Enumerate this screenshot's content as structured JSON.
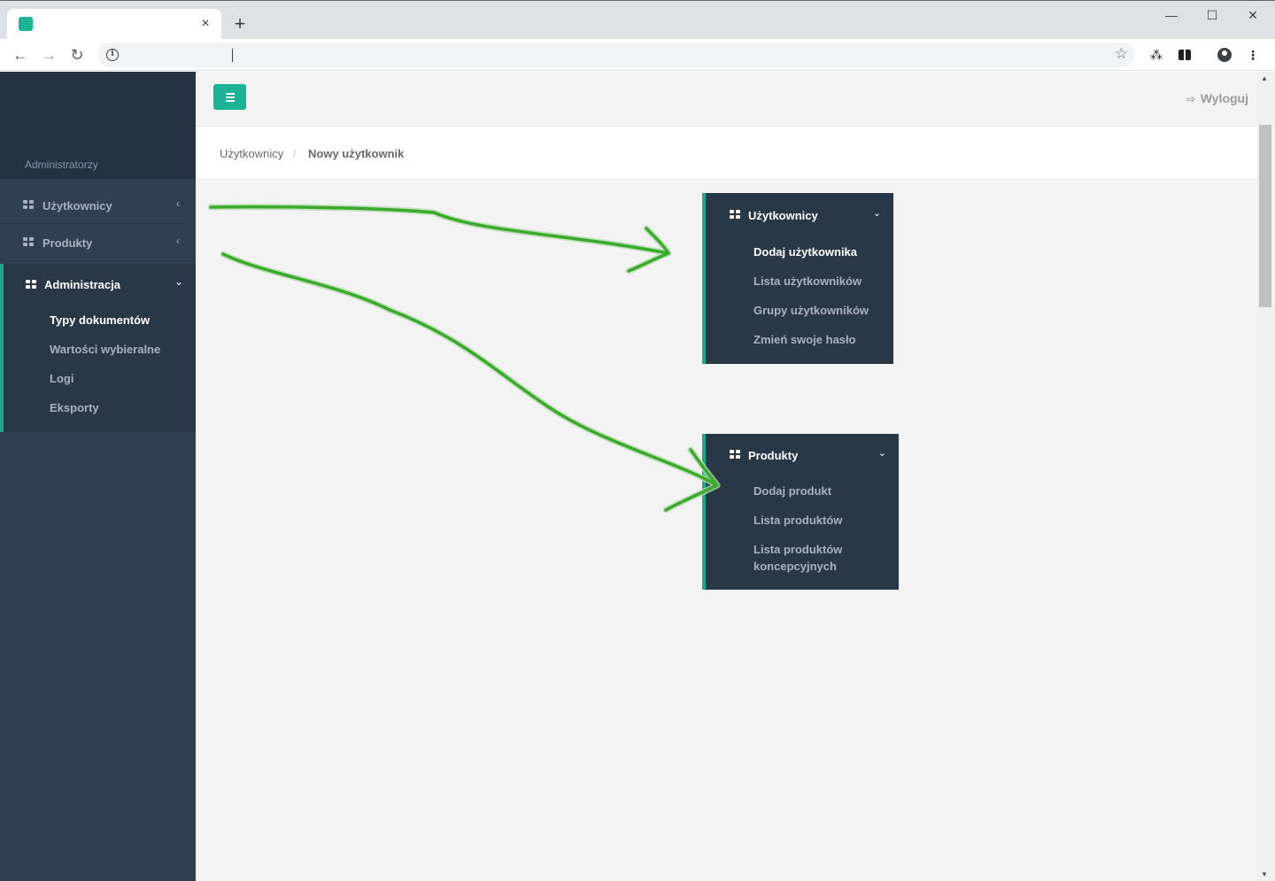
{
  "browser": {
    "tab_title": "",
    "close_glyph": "×",
    "new_tab_glyph": "+",
    "window_controls": {
      "minimize": "—",
      "maximize": "☐",
      "close": "✕"
    },
    "address": ""
  },
  "sidebar": {
    "profile_label": "Administratorzy",
    "items": [
      {
        "label": "Użytkownicy",
        "chevron": "‹"
      },
      {
        "label": "Produkty",
        "chevron": "‹"
      }
    ],
    "active": {
      "label": "Administracja",
      "chevron": "⌄",
      "children": [
        {
          "label": "Typy dokumentów"
        },
        {
          "label": "Wartości wybieralne"
        },
        {
          "label": "Logi"
        },
        {
          "label": "Eksporty"
        }
      ]
    }
  },
  "topbar": {
    "logout_label": "Wyloguj",
    "logout_icon": "sign-out-icon"
  },
  "breadcrumb": {
    "parent": "Użytkownicy",
    "separator": "/",
    "current": "Nowy użytkownik"
  },
  "popups": {
    "users": {
      "label": "Użytkownicy",
      "chevron": "⌄",
      "children": [
        {
          "label": "Dodaj użytkownika"
        },
        {
          "label": "Lista użytkowników"
        },
        {
          "label": "Grupy użytkowników"
        },
        {
          "label": "Zmień swoje hasło"
        }
      ]
    },
    "products": {
      "label": "Produkty",
      "chevron": "⌄",
      "children": [
        {
          "label": "Dodaj produkt"
        },
        {
          "label": "Lista produktów"
        },
        {
          "label": "Lista produktów koncepcyjnych"
        }
      ]
    }
  },
  "colors": {
    "accent": "#1ab394",
    "sidebar_bg": "#2f4050",
    "sidebar_active_bg": "#293846",
    "arrow": "#3aaa2a"
  }
}
